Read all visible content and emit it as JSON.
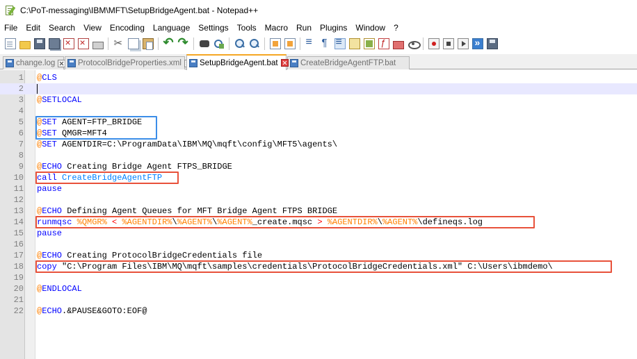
{
  "window": {
    "title": "C:\\PoT-messaging\\IBM\\MFT\\SetupBridgeAgent.bat - Notepad++"
  },
  "menu": {
    "items": [
      "File",
      "Edit",
      "Search",
      "View",
      "Encoding",
      "Language",
      "Settings",
      "Tools",
      "Macro",
      "Run",
      "Plugins",
      "Window",
      "?"
    ]
  },
  "toolbar": {
    "icons": [
      "new-file-icon",
      "open-folder-icon",
      "save-icon",
      "save-all-icon",
      "close-icon",
      "close-all-icon",
      "print-icon",
      "cut-icon",
      "copy-icon",
      "paste-icon",
      "undo-icon",
      "redo-icon",
      "find-icon",
      "replace-icon",
      "zoom-in-icon",
      "zoom-out-icon",
      "sync-vertical-icon",
      "sync-horizontal-icon",
      "word-wrap-icon",
      "show-all-characters-icon",
      "indent-guide-icon",
      "user-defined-language-icon",
      "document-map-icon",
      "function-list-icon",
      "folder-as-workspace-icon",
      "monitoring-icon",
      "start-recording-icon",
      "stop-recording-icon",
      "playback-icon",
      "run-macro-multiple-icon",
      "save-macro-icon"
    ]
  },
  "tabs": [
    {
      "label": "change.log",
      "active": false
    },
    {
      "label": "ProtocolBridgeProperties.xml",
      "active": false
    },
    {
      "label": "SetupBridgeAgent.bat",
      "active": true
    },
    {
      "label": "CreateBridgeAgentFTP.bat",
      "active": false
    }
  ],
  "editor": {
    "current_line": 2,
    "lines": [
      {
        "num": "1",
        "tokens": [
          {
            "t": "@",
            "c": "at"
          },
          {
            "t": "CLS",
            "c": "kw"
          }
        ]
      },
      {
        "num": "2",
        "tokens": []
      },
      {
        "num": "3",
        "tokens": [
          {
            "t": "@",
            "c": "at"
          },
          {
            "t": "SETLOCAL",
            "c": "kw"
          }
        ]
      },
      {
        "num": "4",
        "tokens": []
      },
      {
        "num": "5",
        "tokens": [
          {
            "t": "@",
            "c": "at"
          },
          {
            "t": "SET",
            "c": "kw"
          },
          {
            "t": " AGENT=FTP_BRIDGE",
            "c": "text"
          }
        ]
      },
      {
        "num": "6",
        "tokens": [
          {
            "t": "@",
            "c": "at"
          },
          {
            "t": "SET",
            "c": "kw"
          },
          {
            "t": " QMGR=MFT4",
            "c": "text"
          }
        ]
      },
      {
        "num": "7",
        "tokens": [
          {
            "t": "@",
            "c": "at"
          },
          {
            "t": "SET",
            "c": "kw"
          },
          {
            "t": " AGENTDIR=C:\\ProgramData\\IBM\\MQ\\mqft\\config\\MFT5\\agents\\",
            "c": "text"
          }
        ]
      },
      {
        "num": "8",
        "tokens": []
      },
      {
        "num": "9",
        "tokens": [
          {
            "t": "@",
            "c": "at"
          },
          {
            "t": "ECHO",
            "c": "kw"
          },
          {
            "t": " Creating Bridge Agent FTPS_BRIDGE",
            "c": "text"
          }
        ]
      },
      {
        "num": "10",
        "tokens": [
          {
            "t": "call",
            "c": "kw"
          },
          {
            "t": " CreateBridgeAgentFTP",
            "c": "call"
          }
        ]
      },
      {
        "num": "11",
        "tokens": [
          {
            "t": "pause",
            "c": "kw"
          }
        ]
      },
      {
        "num": "12",
        "tokens": []
      },
      {
        "num": "13",
        "tokens": [
          {
            "t": "@",
            "c": "at"
          },
          {
            "t": "ECHO",
            "c": "kw"
          },
          {
            "t": " Defining Agent Queues for MFT Bridge Agent FTPS BRIDGE",
            "c": "text"
          }
        ]
      },
      {
        "num": "14",
        "tokens": [
          {
            "t": "runmqsc",
            "c": "run"
          },
          {
            "t": " ",
            "c": "text"
          },
          {
            "t": "%QMGR%",
            "c": "var"
          },
          {
            "t": " < ",
            "c": "op"
          },
          {
            "t": "%AGENTDIR%",
            "c": "var"
          },
          {
            "t": "\\",
            "c": "text"
          },
          {
            "t": "%AGENT%",
            "c": "var"
          },
          {
            "t": "\\",
            "c": "text"
          },
          {
            "t": "%AGENT%",
            "c": "var"
          },
          {
            "t": "_create.mqsc",
            "c": "text"
          },
          {
            "t": " > ",
            "c": "op"
          },
          {
            "t": "%AGENTDIR%",
            "c": "var"
          },
          {
            "t": "\\",
            "c": "text"
          },
          {
            "t": "%AGENT%",
            "c": "var"
          },
          {
            "t": "\\defineqs.log",
            "c": "text"
          }
        ]
      },
      {
        "num": "15",
        "tokens": [
          {
            "t": "pause",
            "c": "kw"
          }
        ]
      },
      {
        "num": "16",
        "tokens": []
      },
      {
        "num": "17",
        "tokens": [
          {
            "t": "@",
            "c": "at"
          },
          {
            "t": "ECHO",
            "c": "kw"
          },
          {
            "t": " Creating ProtocolBridgeCredentials file",
            "c": "text"
          }
        ]
      },
      {
        "num": "18",
        "tokens": [
          {
            "t": "copy",
            "c": "kw"
          },
          {
            "t": " \"C:\\Program Files\\IBM\\MQ\\mqft\\samples\\credentials\\ProtocolBridgeCredentials.xml\" C:\\Users\\ibmdemo\\",
            "c": "text"
          }
        ]
      },
      {
        "num": "19",
        "tokens": []
      },
      {
        "num": "20",
        "tokens": [
          {
            "t": "@",
            "c": "at"
          },
          {
            "t": "ENDLOCAL",
            "c": "kw"
          }
        ]
      },
      {
        "num": "21",
        "tokens": []
      },
      {
        "num": "22",
        "tokens": [
          {
            "t": "@",
            "c": "at"
          },
          {
            "t": "ECHO",
            "c": "kw"
          },
          {
            "t": ".&PAUSE&GOTO:EOF@",
            "c": "text"
          }
        ]
      }
    ]
  },
  "highlights": [
    {
      "color": "#3b8de8",
      "lines": "5-6"
    },
    {
      "color": "#e8513a",
      "lines": "10"
    },
    {
      "color": "#e8513a",
      "lines": "14"
    },
    {
      "color": "#e8513a",
      "lines": "18"
    }
  ]
}
